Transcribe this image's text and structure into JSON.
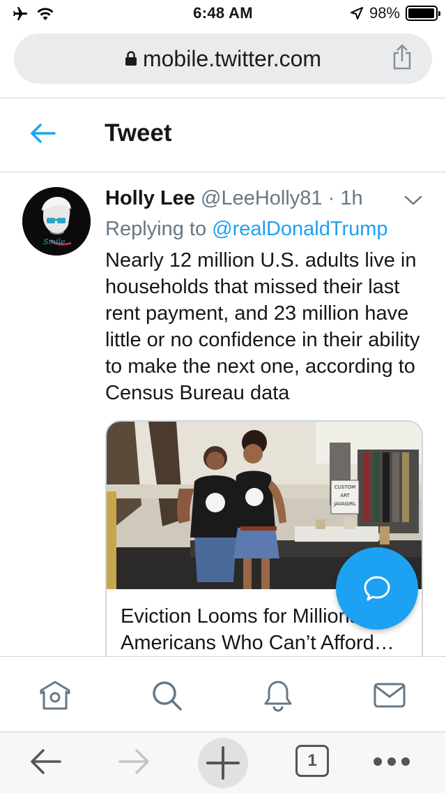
{
  "status_bar": {
    "time": "6:48 AM",
    "battery": "98%",
    "battery_level": 0.98,
    "icons": [
      "airplane-icon",
      "wifi-icon",
      "location-icon",
      "battery-icon"
    ]
  },
  "browser": {
    "url": "mobile.twitter.com"
  },
  "header": {
    "title": "Tweet"
  },
  "tweet": {
    "author_name": "Holly Lee",
    "author_handle": "@LeeHolly81",
    "separator": "·",
    "time": "1h",
    "replying_prefix": "Replying to",
    "replying_to": "@realDonaldTrump",
    "text": "Nearly 12 million U.S. adults live in households that missed their last rent payment, and 23 million have little or no confidence in their ability to make the next one, according to Census Bureau data",
    "avatar_text": "Smile",
    "card": {
      "title": "Eviction Looms for Millions of Americans Who Can’t Afford…",
      "sign_text": "CUSTOM ART JAVAGIRL"
    }
  },
  "tab_bar": {
    "items": [
      "home-icon",
      "search-icon",
      "notifications-icon",
      "messages-icon"
    ]
  },
  "toolbar": {
    "tab_count": "1"
  },
  "colors": {
    "accent": "#1da1f2",
    "text": "#14171a",
    "muted": "#657786",
    "border": "#ccd6dd"
  }
}
